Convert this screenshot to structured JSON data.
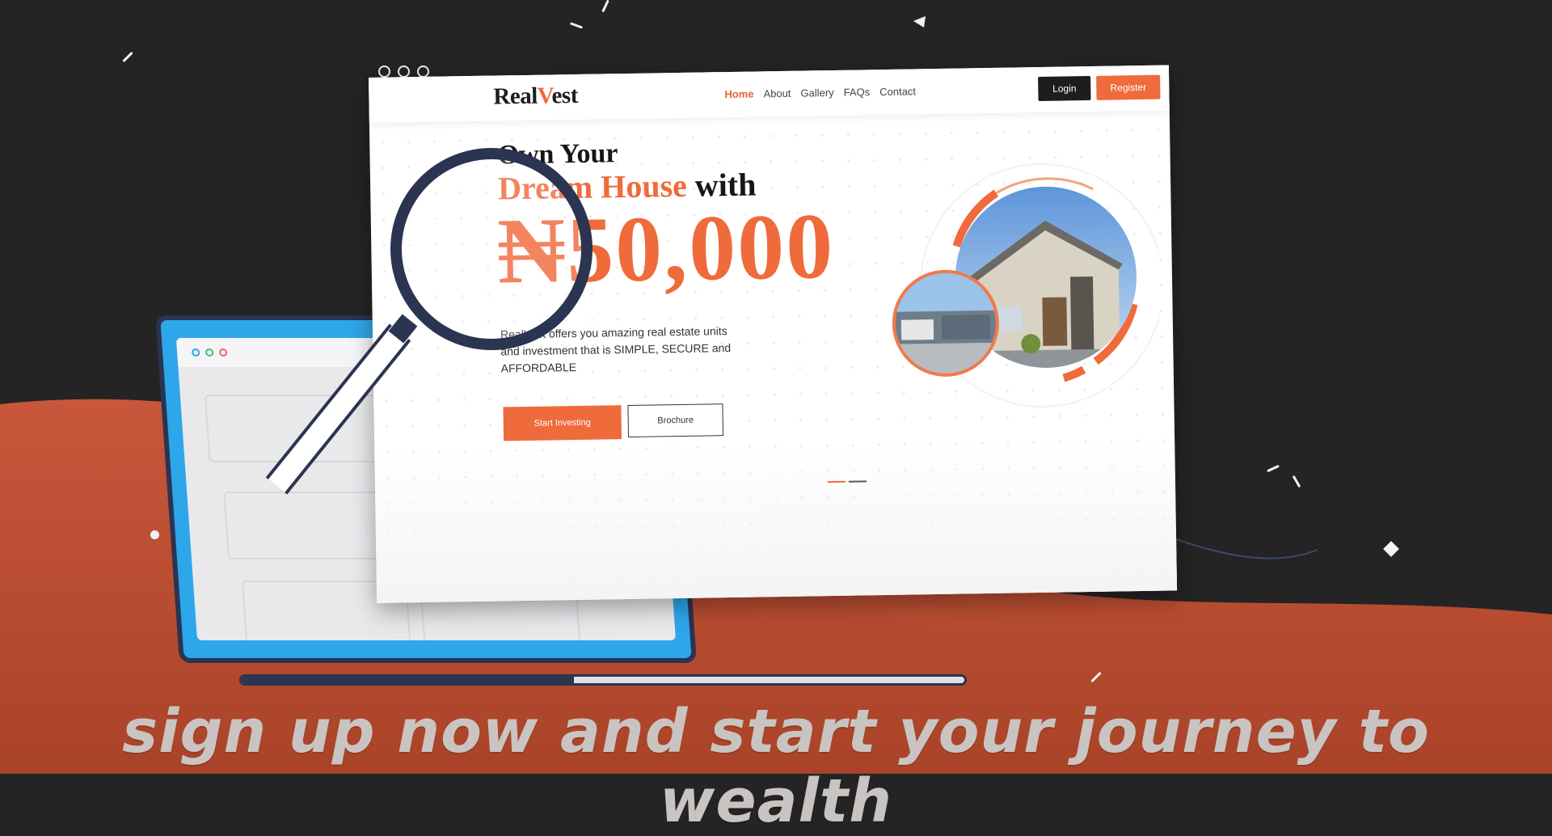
{
  "colors": {
    "background": "#242424",
    "wave": "#c4563a",
    "accent": "#ef6b3c",
    "laptop_blue": "#2ea6ea",
    "laptop_frame": "#2b3450"
  },
  "site": {
    "logo": {
      "prefix": "Real",
      "v": "V",
      "suffix": "est"
    },
    "nav": [
      {
        "label": "Home",
        "active": true
      },
      {
        "label": "About",
        "active": false
      },
      {
        "label": "Gallery",
        "active": false
      },
      {
        "label": "FAQs",
        "active": false
      },
      {
        "label": "Contact",
        "active": false
      }
    ],
    "login_label": "Login",
    "register_label": "Register",
    "hero": {
      "line1": "Own Your",
      "line2_accent": "Dream House",
      "line2_rest": " with",
      "price": "₦50,000",
      "description": "RealVest offers you amazing real estate units and investment that is SIMPLE, SECURE and AFFORDABLE",
      "primary_cta": "Start Investing",
      "secondary_cta": "Brochure"
    }
  },
  "icons": {
    "magnifier": "magnifying-glass-icon",
    "window_controls": "window-dots-icon"
  },
  "video": {
    "progress": 0.46
  },
  "caption": "sign up now and start your journey to wealth"
}
